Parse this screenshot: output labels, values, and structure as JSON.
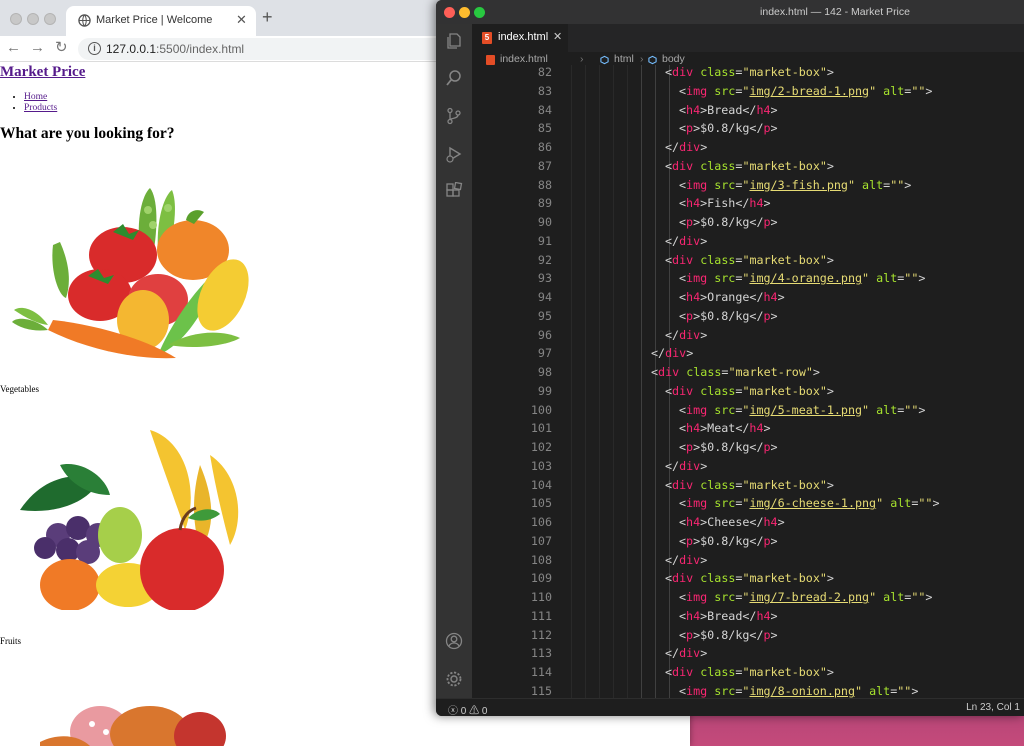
{
  "browser": {
    "tab_title": "Market Price | Welcome",
    "url_host": "127.0.0.1",
    "url_rest": ":5500/index.html"
  },
  "page": {
    "site_title": "Market Price",
    "nav": [
      "Home",
      "Products"
    ],
    "heading": "What are you looking for?",
    "categories": [
      "Vegetables",
      "Fruits"
    ]
  },
  "editor": {
    "window_title": "index.html — 142 - Market Price",
    "tab_label": "index.html",
    "breadcrumbs": [
      "index.html",
      "html",
      "body"
    ],
    "status_errors": "0",
    "status_warnings": "0",
    "status_position": "Ln 23, Col 1",
    "code_lines": [
      {
        "n": "82",
        "indent": 7,
        "html": "<span class=\"pu\">&lt;</span><span class=\"tg\">div</span> <span class=\"at\">class</span><span class=\"pu\">=</span><span class=\"st\">\"market-box\"</span><span class=\"pu\">&gt;</span>"
      },
      {
        "n": "83",
        "indent": 8,
        "html": "<span class=\"pu\">&lt;</span><span class=\"tg\">img</span> <span class=\"at\">src</span><span class=\"pu\">=</span><span class=\"st\">\"<span class=\"ul\">img/2-bread-1.png</span>\"</span> <span class=\"at\">alt</span><span class=\"pu\">=</span><span class=\"st\">\"\"</span><span class=\"pu\">&gt;</span>"
      },
      {
        "n": "84",
        "indent": 8,
        "html": "<span class=\"pu\">&lt;</span><span class=\"tg\">h4</span><span class=\"pu\">&gt;</span>Bread<span class=\"pu\">&lt;/</span><span class=\"tg\">h4</span><span class=\"pu\">&gt;</span>"
      },
      {
        "n": "85",
        "indent": 8,
        "html": "<span class=\"pu\">&lt;</span><span class=\"tg\">p</span><span class=\"pu\">&gt;</span>$0.8/kg<span class=\"pu\">&lt;/</span><span class=\"tg\">p</span><span class=\"pu\">&gt;</span>"
      },
      {
        "n": "86",
        "indent": 7,
        "html": "<span class=\"pu\">&lt;/</span><span class=\"tg\">div</span><span class=\"pu\">&gt;</span>"
      },
      {
        "n": "87",
        "indent": 7,
        "html": "<span class=\"pu\">&lt;</span><span class=\"tg\">div</span> <span class=\"at\">class</span><span class=\"pu\">=</span><span class=\"st\">\"market-box\"</span><span class=\"pu\">&gt;</span>"
      },
      {
        "n": "88",
        "indent": 8,
        "html": "<span class=\"pu\">&lt;</span><span class=\"tg\">img</span> <span class=\"at\">src</span><span class=\"pu\">=</span><span class=\"st\">\"<span class=\"ul\">img/3-fish.png</span>\"</span> <span class=\"at\">alt</span><span class=\"pu\">=</span><span class=\"st\">\"\"</span><span class=\"pu\">&gt;</span>"
      },
      {
        "n": "89",
        "indent": 8,
        "html": "<span class=\"pu\">&lt;</span><span class=\"tg\">h4</span><span class=\"pu\">&gt;</span>Fish<span class=\"pu\">&lt;/</span><span class=\"tg\">h4</span><span class=\"pu\">&gt;</span>"
      },
      {
        "n": "90",
        "indent": 8,
        "html": "<span class=\"pu\">&lt;</span><span class=\"tg\">p</span><span class=\"pu\">&gt;</span>$0.8/kg<span class=\"pu\">&lt;/</span><span class=\"tg\">p</span><span class=\"pu\">&gt;</span>"
      },
      {
        "n": "91",
        "indent": 7,
        "html": "<span class=\"pu\">&lt;/</span><span class=\"tg\">div</span><span class=\"pu\">&gt;</span>"
      },
      {
        "n": "92",
        "indent": 7,
        "html": "<span class=\"pu\">&lt;</span><span class=\"tg\">div</span> <span class=\"at\">class</span><span class=\"pu\">=</span><span class=\"st\">\"market-box\"</span><span class=\"pu\">&gt;</span>"
      },
      {
        "n": "93",
        "indent": 8,
        "html": "<span class=\"pu\">&lt;</span><span class=\"tg\">img</span> <span class=\"at\">src</span><span class=\"pu\">=</span><span class=\"st\">\"<span class=\"ul\">img/4-orange.png</span>\"</span> <span class=\"at\">alt</span><span class=\"pu\">=</span><span class=\"st\">\"\"</span><span class=\"pu\">&gt;</span>"
      },
      {
        "n": "94",
        "indent": 8,
        "html": "<span class=\"pu\">&lt;</span><span class=\"tg\">h4</span><span class=\"pu\">&gt;</span>Orange<span class=\"pu\">&lt;/</span><span class=\"tg\">h4</span><span class=\"pu\">&gt;</span>"
      },
      {
        "n": "95",
        "indent": 8,
        "html": "<span class=\"pu\">&lt;</span><span class=\"tg\">p</span><span class=\"pu\">&gt;</span>$0.8/kg<span class=\"pu\">&lt;/</span><span class=\"tg\">p</span><span class=\"pu\">&gt;</span>"
      },
      {
        "n": "96",
        "indent": 7,
        "html": "<span class=\"pu\">&lt;/</span><span class=\"tg\">div</span><span class=\"pu\">&gt;</span>"
      },
      {
        "n": "97",
        "indent": 6,
        "html": "<span class=\"pu\">&lt;/</span><span class=\"tg\">div</span><span class=\"pu\">&gt;</span>"
      },
      {
        "n": "98",
        "indent": 6,
        "html": "<span class=\"pu\">&lt;</span><span class=\"tg\">div</span> <span class=\"at\">class</span><span class=\"pu\">=</span><span class=\"st\">\"market-row\"</span><span class=\"pu\">&gt;</span>"
      },
      {
        "n": "99",
        "indent": 7,
        "html": "<span class=\"pu\">&lt;</span><span class=\"tg\">div</span> <span class=\"at\">class</span><span class=\"pu\">=</span><span class=\"st\">\"market-box\"</span><span class=\"pu\">&gt;</span>"
      },
      {
        "n": "100",
        "indent": 8,
        "html": "<span class=\"pu\">&lt;</span><span class=\"tg\">img</span> <span class=\"at\">src</span><span class=\"pu\">=</span><span class=\"st\">\"<span class=\"ul\">img/5-meat-1.png</span>\"</span> <span class=\"at\">alt</span><span class=\"pu\">=</span><span class=\"st\">\"\"</span><span class=\"pu\">&gt;</span>"
      },
      {
        "n": "101",
        "indent": 8,
        "html": "<span class=\"pu\">&lt;</span><span class=\"tg\">h4</span><span class=\"pu\">&gt;</span>Meat<span class=\"pu\">&lt;/</span><span class=\"tg\">h4</span><span class=\"pu\">&gt;</span>"
      },
      {
        "n": "102",
        "indent": 8,
        "html": "<span class=\"pu\">&lt;</span><span class=\"tg\">p</span><span class=\"pu\">&gt;</span>$0.8/kg<span class=\"pu\">&lt;/</span><span class=\"tg\">p</span><span class=\"pu\">&gt;</span>"
      },
      {
        "n": "103",
        "indent": 7,
        "html": "<span class=\"pu\">&lt;/</span><span class=\"tg\">div</span><span class=\"pu\">&gt;</span>"
      },
      {
        "n": "104",
        "indent": 7,
        "html": "<span class=\"pu\">&lt;</span><span class=\"tg\">div</span> <span class=\"at\">class</span><span class=\"pu\">=</span><span class=\"st\">\"market-box\"</span><span class=\"pu\">&gt;</span>"
      },
      {
        "n": "105",
        "indent": 8,
        "html": "<span class=\"pu\">&lt;</span><span class=\"tg\">img</span> <span class=\"at\">src</span><span class=\"pu\">=</span><span class=\"st\">\"<span class=\"ul\">img/6-cheese-1.png</span>\"</span> <span class=\"at\">alt</span><span class=\"pu\">=</span><span class=\"st\">\"\"</span><span class=\"pu\">&gt;</span>"
      },
      {
        "n": "106",
        "indent": 8,
        "html": "<span class=\"pu\">&lt;</span><span class=\"tg\">h4</span><span class=\"pu\">&gt;</span>Cheese<span class=\"pu\">&lt;/</span><span class=\"tg\">h4</span><span class=\"pu\">&gt;</span>"
      },
      {
        "n": "107",
        "indent": 8,
        "html": "<span class=\"pu\">&lt;</span><span class=\"tg\">p</span><span class=\"pu\">&gt;</span>$0.8/kg<span class=\"pu\">&lt;/</span><span class=\"tg\">p</span><span class=\"pu\">&gt;</span>"
      },
      {
        "n": "108",
        "indent": 7,
        "html": "<span class=\"pu\">&lt;/</span><span class=\"tg\">div</span><span class=\"pu\">&gt;</span>"
      },
      {
        "n": "109",
        "indent": 7,
        "html": "<span class=\"pu\">&lt;</span><span class=\"tg\">div</span> <span class=\"at\">class</span><span class=\"pu\">=</span><span class=\"st\">\"market-box\"</span><span class=\"pu\">&gt;</span>"
      },
      {
        "n": "110",
        "indent": 8,
        "html": "<span class=\"pu\">&lt;</span><span class=\"tg\">img</span> <span class=\"at\">src</span><span class=\"pu\">=</span><span class=\"st\">\"<span class=\"ul\">img/7-bread-2.png</span>\"</span> <span class=\"at\">alt</span><span class=\"pu\">=</span><span class=\"st\">\"\"</span><span class=\"pu\">&gt;</span>"
      },
      {
        "n": "111",
        "indent": 8,
        "html": "<span class=\"pu\">&lt;</span><span class=\"tg\">h4</span><span class=\"pu\">&gt;</span>Bread<span class=\"pu\">&lt;/</span><span class=\"tg\">h4</span><span class=\"pu\">&gt;</span>"
      },
      {
        "n": "112",
        "indent": 8,
        "html": "<span class=\"pu\">&lt;</span><span class=\"tg\">p</span><span class=\"pu\">&gt;</span>$0.8/kg<span class=\"pu\">&lt;/</span><span class=\"tg\">p</span><span class=\"pu\">&gt;</span>"
      },
      {
        "n": "113",
        "indent": 7,
        "html": "<span class=\"pu\">&lt;/</span><span class=\"tg\">div</span><span class=\"pu\">&gt;</span>"
      },
      {
        "n": "114",
        "indent": 7,
        "html": "<span class=\"pu\">&lt;</span><span class=\"tg\">div</span> <span class=\"at\">class</span><span class=\"pu\">=</span><span class=\"st\">\"market-box\"</span><span class=\"pu\">&gt;</span>"
      },
      {
        "n": "115",
        "indent": 8,
        "html": "<span class=\"pu\">&lt;</span><span class=\"tg\">img</span> <span class=\"at\">src</span><span class=\"pu\">=</span><span class=\"st\">\"<span class=\"ul\">img/8-onion.png</span>\"</span> <span class=\"at\">alt</span><span class=\"pu\">=</span><span class=\"st\">\"\"</span><span class=\"pu\">&gt;</span>"
      }
    ]
  },
  "icons": {
    "browser_back": "arrow-left-icon",
    "browser_forward": "arrow-right-icon",
    "browser_reload": "reload-icon",
    "explorer": "files-icon",
    "search": "search-icon",
    "source_control": "source-control-icon",
    "run": "run-debug-icon",
    "extensions": "extensions-icon",
    "account": "account-icon",
    "settings": "gear-icon"
  },
  "colors": {
    "tag": "#f92672",
    "attribute": "#a6e22e",
    "string": "#e6db74",
    "link_visited": "#551a8b",
    "editor_bg": "#1e1e1e"
  }
}
